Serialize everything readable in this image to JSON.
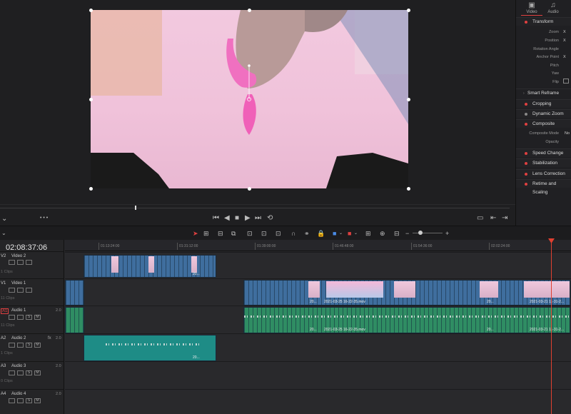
{
  "inspector": {
    "tabs": [
      {
        "label": "Video",
        "icon": "film-icon"
      },
      {
        "label": "Audio",
        "icon": "music-note-icon"
      }
    ],
    "sections": {
      "transform": "Transform",
      "smart_reframe": "Smart Reframe",
      "cropping": "Cropping",
      "dynamic_zoom": "Dynamic Zoom",
      "composite": "Composite",
      "speed_change": "Speed Change",
      "stabilization": "Stabilization",
      "lens_correction": "Lens Correction",
      "retime_scaling": "Retime and Scaling"
    },
    "props": {
      "zoom": "Zoom",
      "position": "Position",
      "rotation": "Rotation Angle",
      "anchor": "Anchor Point",
      "pitch": "Pitch",
      "yaw": "Yaw",
      "flip": "Flip",
      "composite_mode": "Composite Mode",
      "composite_mode_value": "No",
      "opacity": "Opacity",
      "x": "X"
    }
  },
  "timeline": {
    "timecode": "02:08:37:06",
    "ruler": [
      "01:13:24:00",
      "01:31:12:00",
      "01:39:00:00",
      "01:46:48:00",
      "01:54:36:00",
      "02:02:24:00"
    ],
    "tracks": [
      {
        "id": "V2",
        "name": "Video 2",
        "sub": "1 Clips"
      },
      {
        "id": "V1",
        "name": "Video 1",
        "sub": "11 Clips"
      },
      {
        "id": "A1",
        "name": "Audio 1",
        "ch": "2.0",
        "sub": "11 Clips"
      },
      {
        "id": "A2",
        "name": "Audio 2",
        "ch": "2.0",
        "fx": "fx",
        "sub": "1 Clips"
      },
      {
        "id": "A3",
        "name": "Audio 3",
        "ch": "2.0",
        "sub": "0 Clips"
      },
      {
        "id": "A4",
        "name": "Audio 4",
        "ch": "2.0",
        "sub": ""
      }
    ],
    "clip_labels": {
      "short": "20...",
      "main": "2021-03-25 16-22-35.mov",
      "right": "2021-03-21 11-31-2..."
    },
    "track_buttons": {
      "solo": "S",
      "mute": "M"
    }
  },
  "colors": {
    "playhead": "#e04030",
    "video_clip": "#3f6e9e",
    "audio_clip": "#2f8d63",
    "accent": "#e04040"
  }
}
